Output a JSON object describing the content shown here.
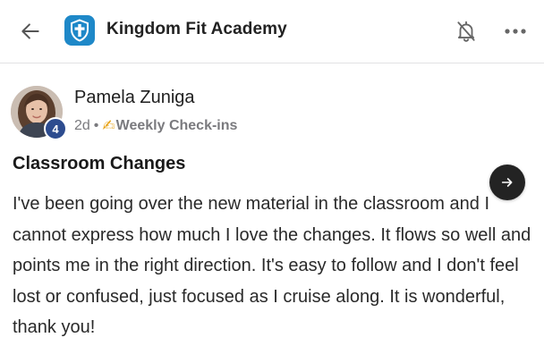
{
  "header": {
    "title": "Kingdom Fit Academy",
    "back_icon": "arrow-left-icon",
    "logo_icon": "cross-shield-logo-icon",
    "notification_icon": "bell-muted-icon",
    "more_icon": "more-horizontal-icon",
    "logo_color": "#1e88c8"
  },
  "post": {
    "author": {
      "name": "Pamela Zuniga",
      "level": "4",
      "avatar_icon": "user-avatar"
    },
    "meta": {
      "time": "2d",
      "separator": "•",
      "category_emoji": "✍",
      "category": "Weekly Check-ins"
    },
    "title": "Classroom Changes",
    "body": "I've been going over the new material in the classroom and I cannot express how much I love the changes. It flows so well and points me in the right direction. It's easy to follow and I don't feel lost or confused, just focused as I cruise along. It is wonderful, thank you!",
    "next_icon": "arrow-right-icon"
  },
  "colors": {
    "badge": "#2d4c8f",
    "next_button": "#232323",
    "meta_text": "#7a7a7e"
  }
}
